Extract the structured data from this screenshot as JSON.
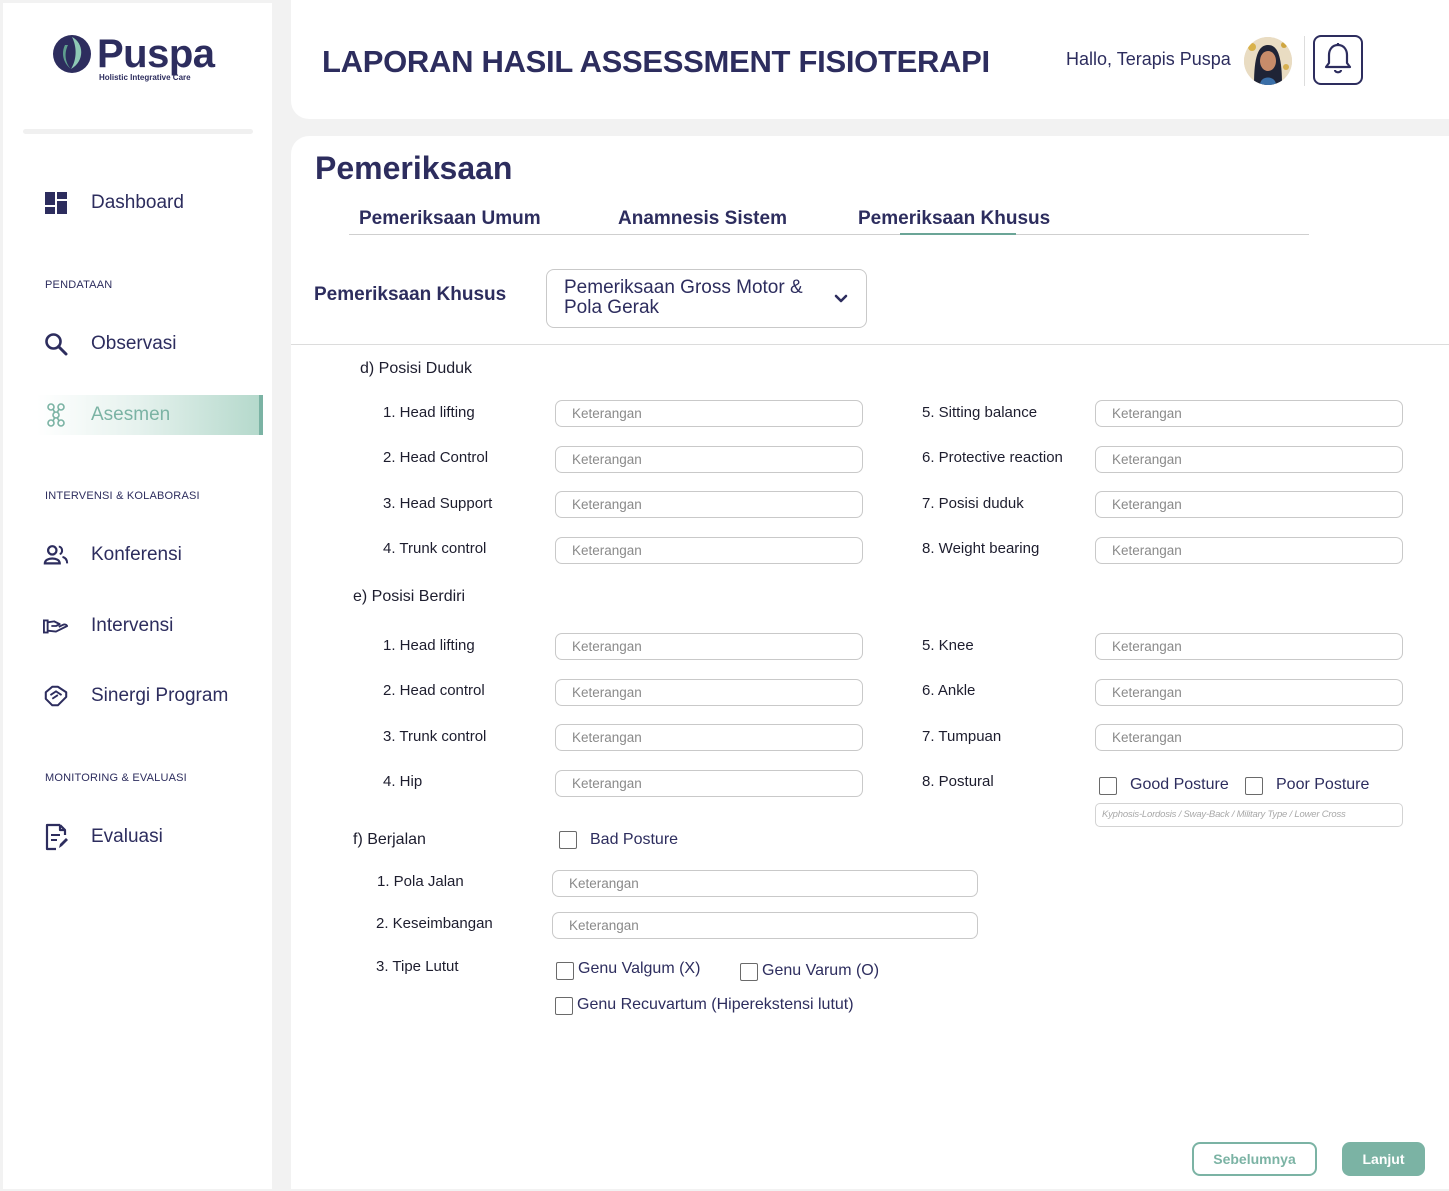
{
  "brand": {
    "name": "Puspa",
    "tagline": "Holistic Integrative Care"
  },
  "sidebar": {
    "items": [
      {
        "label": "Dashboard",
        "icon": "dashboard-icon"
      },
      {
        "label": "Observasi",
        "icon": "search-icon"
      },
      {
        "label": "Asesmen",
        "icon": "molecule-icon",
        "active": true
      },
      {
        "label": "Konferensi",
        "icon": "people-icon"
      },
      {
        "label": "Intervensi",
        "icon": "hand-icon"
      },
      {
        "label": "Sinergi Program",
        "icon": "handshake-icon"
      },
      {
        "label": "Evaluasi",
        "icon": "document-edit-icon"
      }
    ],
    "sections": [
      "PENDATAAN",
      "INTERVENSI & KOLABORASI",
      "MONITORING & EVALUASI"
    ]
  },
  "header": {
    "title": "LAPORAN HASIL ASSESSMENT FISIOTERAPI",
    "greeting": "Hallo, Terapis Puspa"
  },
  "main": {
    "title": "Pemeriksaan",
    "tabs": [
      {
        "label": "Pemeriksaan Umum"
      },
      {
        "label": "Anamnesis Sistem"
      },
      {
        "label": "Pemeriksaan Khusus",
        "active": true
      }
    ],
    "khusus_label": "Pemeriksaan Khusus",
    "khusus_selected": "Pemeriksaan Gross Motor & Pola Gerak",
    "placeholder": "Keterangan",
    "posisi_duduk": {
      "title": "d) Posisi Duduk",
      "left": [
        "1. Head lifting",
        "2. Head Control",
        "3. Head Support",
        "4. Trunk control"
      ],
      "right": [
        "5. Sitting balance",
        "6. Protective reaction",
        "7. Posisi duduk",
        "8. Weight bearing"
      ]
    },
    "posisi_berdiri": {
      "title": "e) Posisi Berdiri",
      "left": [
        "1. Head lifting",
        "2. Head control",
        "3. Trunk control",
        "4. Hip"
      ],
      "right": [
        "5. Knee",
        "6. Ankle",
        "7. Tumpuan",
        "8. Postural"
      ],
      "good_posture": "Good Posture",
      "poor_posture": "Poor Posture",
      "posture_placeholder": "Kyphosis-Lordosis / Sway-Back / Military Type / Lower Cross"
    },
    "berjalan": {
      "title": "f) Berjalan",
      "bad_posture": "Bad Posture",
      "pola_jalan": "1. Pola Jalan",
      "keseimbangan": "2. Keseimbangan",
      "tipe_lutut": "3. Tipe Lutut",
      "genu_valgum": "Genu Valgum (X)",
      "genu_varum": "Genu Varum (O)",
      "genu_recuvartum": "Genu Recuvartum (Hiperekstensi lutut)"
    },
    "btn_prev": "Sebelumnya",
    "btn_next": "Lanjut"
  },
  "colors": {
    "primary": "#2d2d5e",
    "accent": "#7bb3a4",
    "background": "#f2f2f2"
  }
}
